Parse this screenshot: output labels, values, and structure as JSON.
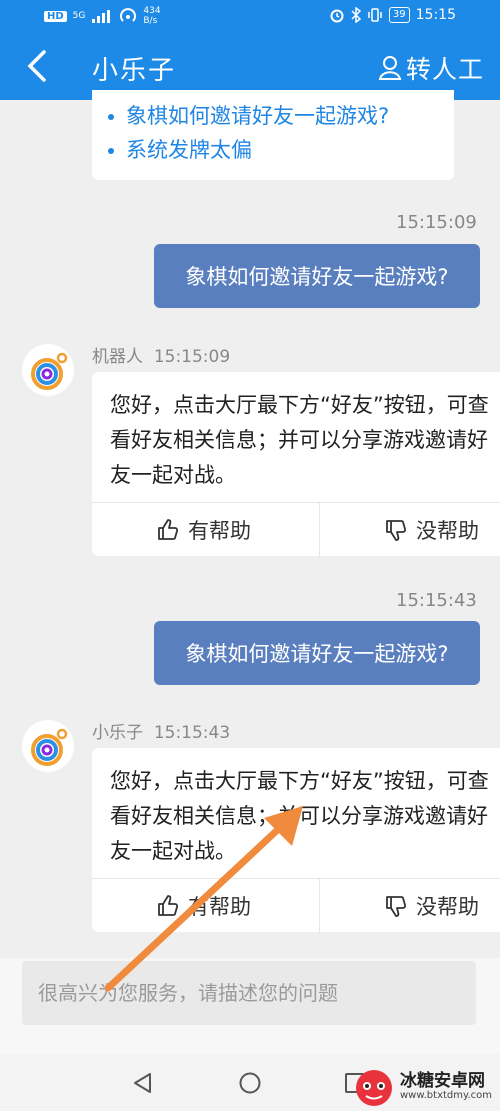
{
  "status_bar": {
    "network": "HD",
    "signal": "5G",
    "speed_value": "434",
    "speed_unit": "B/s",
    "battery": "39",
    "time": "15:15"
  },
  "header": {
    "title": "小乐子",
    "agent_label": "转人工"
  },
  "faq": {
    "items": [
      "象棋如何邀请好友一起游戏?",
      "系统发牌太偏"
    ]
  },
  "messages": [
    {
      "time": "15:15:09",
      "user_text": "象棋如何邀请好友一起游戏?",
      "bot_name": "机器人",
      "bot_time": "15:15:09",
      "bot_text": "您好，点击大厅最下方“好友”按钮，可查\n看好友相关信息；并可以分享游戏邀请好\n友一起对战。",
      "helpful": "有帮助",
      "not_helpful": "没帮助"
    },
    {
      "time": "15:15:43",
      "user_text": "象棋如何邀请好友一起游戏?",
      "bot_name": "小乐子",
      "bot_time": "15:15:43",
      "bot_text": "您好，点击大厅最下方“好友”按钮，可查\n看好友相关信息；并可以分享游戏邀请好\n友一起对战。",
      "helpful": "有帮助",
      "not_helpful": "没帮助"
    }
  ],
  "input": {
    "placeholder": "很高兴为您服务，请描述您的问题"
  },
  "watermark": {
    "text": "冰糖安卓网",
    "url": "www.btxtdmy.com"
  },
  "colors": {
    "header": "#1e8ae8",
    "user_bubble": "#5a7fbf",
    "link": "#1f86e5",
    "arrow": "#f08a3c"
  }
}
